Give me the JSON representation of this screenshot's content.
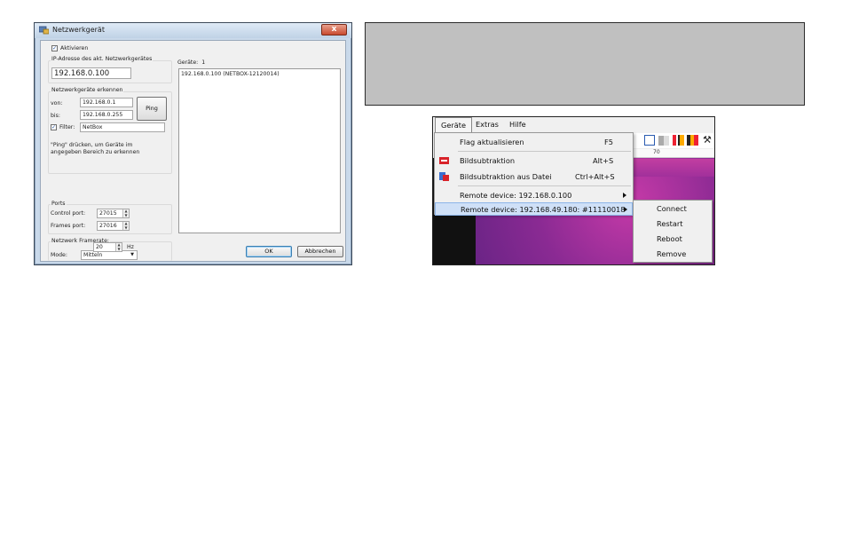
{
  "dialog": {
    "title": "Netzwerkgerät",
    "close_label": "x",
    "activate_label": "Aktivieren",
    "activate_checked": true,
    "ip_group_label": "IP-Adresse des akt. Netzwerkgerätes",
    "ip_value": "192.168.0.100",
    "detect_group_label": "Netzwerkgeräte erkennen",
    "from_label": "von:",
    "from_value": "192.168.0.1",
    "to_label": "bis:",
    "to_value": "192.168.0.255",
    "ping_label": "Ping",
    "filter_label": "Filter:",
    "filter_checked": true,
    "filter_value": "NetBox",
    "hint_line1": "\"Ping\" drücken, um Geräte im",
    "hint_line2": "angegeben Bereich zu erkennen",
    "ports_group_label": "Ports",
    "control_port_label": "Control port:",
    "control_port_value": "27015",
    "frames_port_label": "Frames port:",
    "frames_port_value": "27016",
    "framerate_group_label": "Netzwerk Framerate:",
    "mode_label": "Mode:",
    "mode_value": "Mitteln",
    "hz_value": "20",
    "hz_unit": "Hz",
    "devices_label": "Geräte:",
    "devices_count": "1",
    "device_list": [
      "192.168.0.100 (NETBOX-12120014)"
    ],
    "ok_label": "OK",
    "cancel_label": "Abbrechen"
  },
  "menu": {
    "menubar": [
      "Geräte",
      "Extras",
      "Hilfe"
    ],
    "items": [
      {
        "label": "Flag aktualisieren",
        "shortcut": "F5"
      },
      {
        "label": "Bildsubtraktion",
        "shortcut": "Alt+S"
      },
      {
        "label": "Bildsubtraktion aus Datei",
        "shortcut": "Ctrl+Alt+S"
      },
      {
        "label": "Remote device: 192.168.0.100",
        "shortcut": ""
      },
      {
        "label": "Remote device: 192.168.49.180:  #11110018",
        "shortcut": ""
      }
    ],
    "submenu": [
      "Connect",
      "Restart",
      "Reboot",
      "Remove"
    ],
    "ruler_label": "70"
  },
  "colors": {
    "highlight": "#cfe0f7",
    "thermal": "#8a2a93",
    "gray_panel": "#c0c0c0"
  }
}
